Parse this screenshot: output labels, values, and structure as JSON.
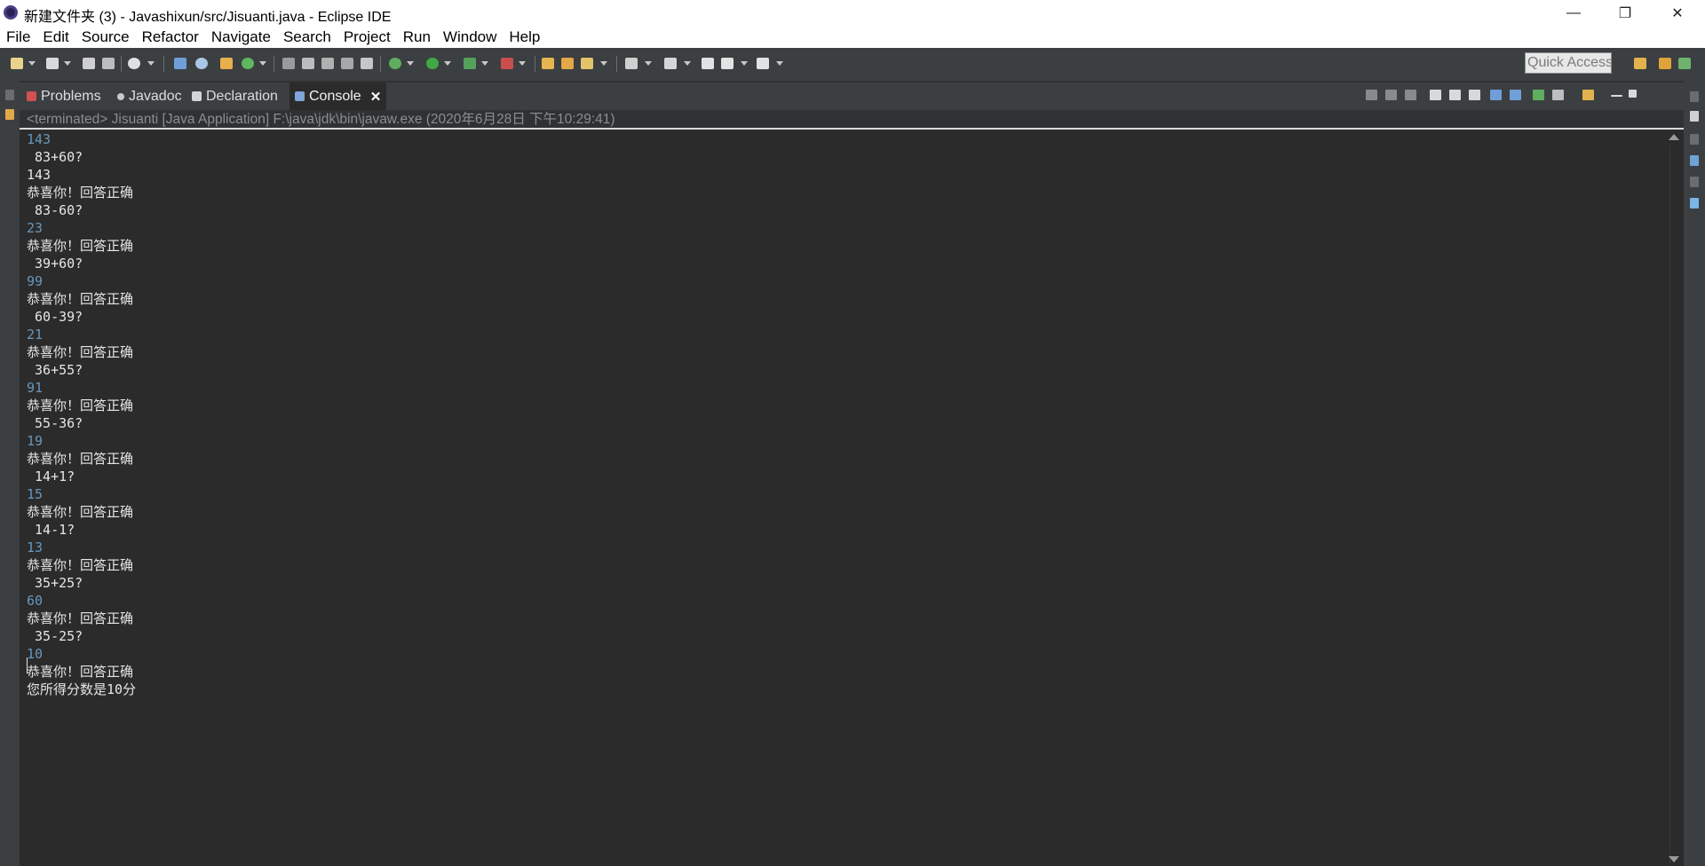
{
  "window": {
    "title": "新建文件夹 (3) - Javashixun/src/Jisuanti.java - Eclipse IDE",
    "minimize_glyph": "—",
    "restore_glyph": "❐",
    "close_glyph": "✕"
  },
  "menu": [
    "File",
    "Edit",
    "Source",
    "Refactor",
    "Navigate",
    "Search",
    "Project",
    "Run",
    "Window",
    "Help"
  ],
  "toolbar": {
    "quick_access_placeholder": "Quick Access"
  },
  "tabs": [
    {
      "label": "Problems",
      "icon": "problems-icon"
    },
    {
      "label": "Javadoc",
      "icon": "javadoc-icon"
    },
    {
      "label": "Declaration",
      "icon": "declaration-icon"
    },
    {
      "label": "Console",
      "icon": "console-icon",
      "active": true,
      "close": "✕"
    }
  ],
  "console": {
    "status": "<terminated> Jisuanti [Java Application] F:\\java\\jdk\\bin\\javaw.exe (2020年6月28日 下午10:29:41)",
    "lines": [
      {
        "text": "143",
        "kind": "input"
      },
      {
        "text": " 83+60?",
        "kind": "output"
      },
      {
        "text": "143",
        "kind": "output"
      },
      {
        "text": "恭喜你！回答正确",
        "kind": "output"
      },
      {
        "text": " 83-60?",
        "kind": "output"
      },
      {
        "text": "23",
        "kind": "input"
      },
      {
        "text": "恭喜你！回答正确",
        "kind": "output"
      },
      {
        "text": " 39+60?",
        "kind": "output"
      },
      {
        "text": "99",
        "kind": "input"
      },
      {
        "text": "恭喜你！回答正确",
        "kind": "output"
      },
      {
        "text": " 60-39?",
        "kind": "output"
      },
      {
        "text": "21",
        "kind": "input"
      },
      {
        "text": "恭喜你！回答正确",
        "kind": "output"
      },
      {
        "text": " 36+55?",
        "kind": "output"
      },
      {
        "text": "91",
        "kind": "input"
      },
      {
        "text": "恭喜你！回答正确",
        "kind": "output"
      },
      {
        "text": " 55-36?",
        "kind": "output"
      },
      {
        "text": "19",
        "kind": "input"
      },
      {
        "text": "恭喜你！回答正确",
        "kind": "output"
      },
      {
        "text": " 14+1?",
        "kind": "output"
      },
      {
        "text": "15",
        "kind": "input"
      },
      {
        "text": "恭喜你！回答正确",
        "kind": "output"
      },
      {
        "text": " 14-1?",
        "kind": "output"
      },
      {
        "text": "13",
        "kind": "input"
      },
      {
        "text": "恭喜你！回答正确",
        "kind": "output"
      },
      {
        "text": " 35+25?",
        "kind": "output"
      },
      {
        "text": "60",
        "kind": "input"
      },
      {
        "text": "恭喜你！回答正确",
        "kind": "output"
      },
      {
        "text": " 35-25?",
        "kind": "output"
      },
      {
        "text": "10",
        "kind": "input"
      },
      {
        "text": "恭喜你！回答正确",
        "kind": "output"
      },
      {
        "text": "您所得分数是10分",
        "kind": "output"
      }
    ]
  },
  "colors": {
    "input_text": "#6897bb",
    "output_text": "#e6e6e6",
    "console_bg": "#2b2b2b",
    "chrome_bg": "#3c3f41"
  }
}
